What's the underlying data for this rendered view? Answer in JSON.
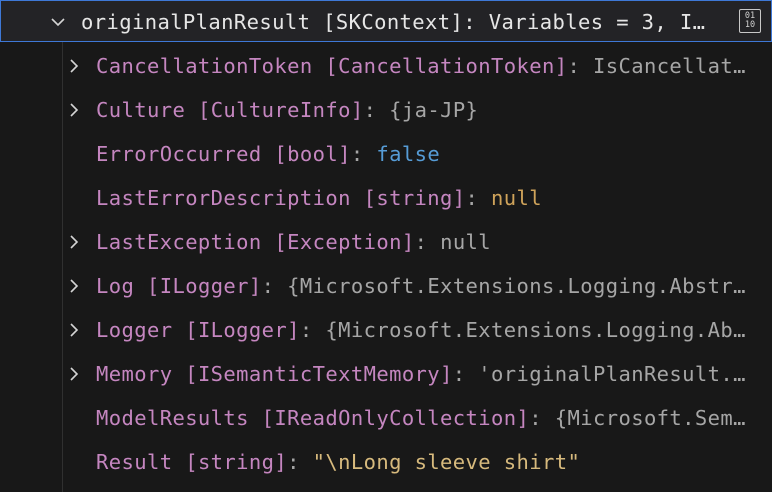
{
  "root": {
    "name": "originalPlanResult",
    "type": "[SKContext]",
    "separator": ":",
    "value": "Variables = 3, I…",
    "expanded": true,
    "binary_icon": {
      "line1": "01",
      "line2": "10"
    }
  },
  "children": [
    {
      "name": "CancellationToken",
      "type": "[CancellationToken]",
      "separator": ":",
      "value": "IsCancellat…",
      "value_kind": "plain",
      "expandable": true
    },
    {
      "name": "Culture",
      "type": "[CultureInfo]",
      "separator": ":",
      "value": "{ja-JP}",
      "value_kind": "plain",
      "expandable": true
    },
    {
      "name": "ErrorOccurred",
      "type": "[bool]",
      "separator": ":",
      "value": "false",
      "value_kind": "bool",
      "expandable": false
    },
    {
      "name": "LastErrorDescription",
      "type": "[string]",
      "separator": ":",
      "value": "null",
      "value_kind": "null",
      "expandable": false
    },
    {
      "name": "LastException",
      "type": "[Exception]",
      "separator": ":",
      "value": "null",
      "value_kind": "plain",
      "expandable": true
    },
    {
      "name": "Log",
      "type": "[ILogger]",
      "separator": ":",
      "value": "{Microsoft.Extensions.Logging.Abstr…",
      "value_kind": "plain",
      "expandable": true
    },
    {
      "name": "Logger",
      "type": "[ILogger]",
      "separator": ":",
      "value": "{Microsoft.Extensions.Logging.Ab…",
      "value_kind": "plain",
      "expandable": true
    },
    {
      "name": "Memory",
      "type": "[ISemanticTextMemory]",
      "separator": ":",
      "value": "'originalPlanResult.…",
      "value_kind": "plain",
      "expandable": true
    },
    {
      "name": "ModelResults",
      "type": "[IReadOnlyCollection]",
      "separator": ":",
      "value": "{Microsoft.Sem…",
      "value_kind": "plain",
      "expandable": false
    },
    {
      "name": "Result",
      "type": "[string]",
      "separator": ":",
      "value": "\"\\nLong sleeve shirt\"",
      "value_kind": "string",
      "expandable": false
    }
  ]
}
